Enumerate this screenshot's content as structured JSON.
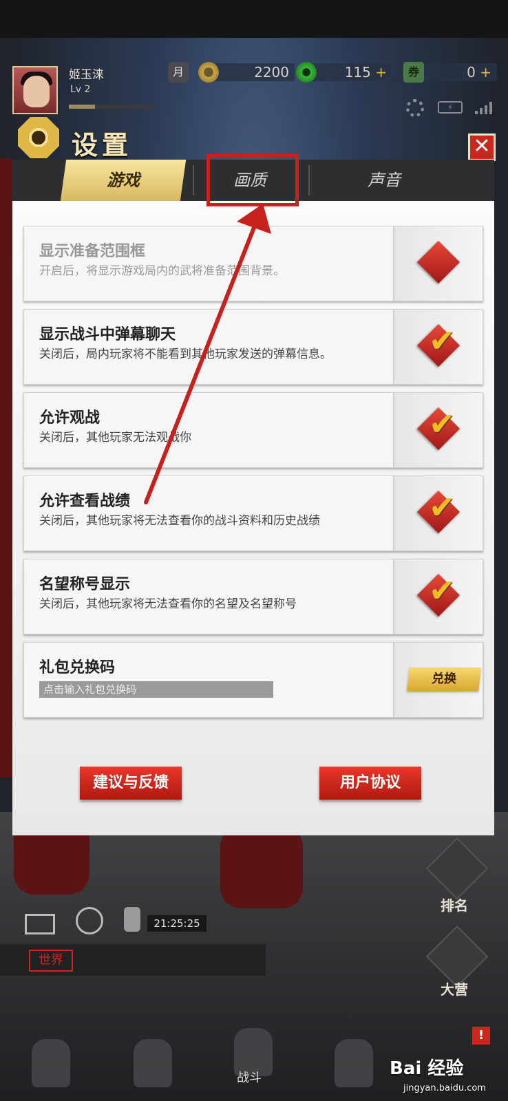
{
  "player": {
    "name": "姬玉涞",
    "level": "Lv 2",
    "xp_fraction": 0.3
  },
  "resources": {
    "coins": "2200",
    "jade": "115",
    "tickets": "0",
    "plus": "+",
    "calendar_glyph": "月",
    "ticket_glyph": "券"
  },
  "status": {
    "battery_glyph": "⚡"
  },
  "dialog": {
    "title": "设置",
    "close": "✕",
    "tabs": [
      {
        "label": "游戏",
        "active": true
      },
      {
        "label": "画质",
        "active": false,
        "highlighted": true
      },
      {
        "label": "声音",
        "active": false
      }
    ],
    "rows": [
      {
        "title": "显示准备范围框",
        "desc": "开启后，将显示游戏局内的武将准备范围背景。",
        "checked": false,
        "disabled": true
      },
      {
        "title": "显示战斗中弹幕聊天",
        "desc": "关闭后，局内玩家将不能看到其他玩家发送的弹幕信息。",
        "checked": true,
        "disabled": false
      },
      {
        "title": "允许观战",
        "desc": "关闭后，其他玩家无法观战你",
        "checked": true,
        "disabled": false
      },
      {
        "title": "允许查看战绩",
        "desc": "关闭后，其他玩家将无法查看你的战斗资料和历史战绩",
        "checked": true,
        "disabled": false
      },
      {
        "title": "名望称号显示",
        "desc": "关闭后，其他玩家将无法查看你的名望及名望称号",
        "checked": true,
        "disabled": false
      }
    ],
    "gift": {
      "title": "礼包兑换码",
      "placeholder": "点击输入礼包兑换码",
      "button": "兑换"
    },
    "feedback_button": "建议与反馈",
    "agreement_button": "用户协议"
  },
  "check_glyph": "✔",
  "hud": {
    "time": "21:25:25",
    "world_channel": "世界",
    "ranking": "排名",
    "camp": "大营",
    "battle": "战斗",
    "alert": "!"
  },
  "watermark": {
    "main": "Bai 经验",
    "sub": "jingyan.baidu.com"
  },
  "colors": {
    "accent_red": "#c8281e",
    "gold": "#e0b848",
    "tab_active": "#f0d880"
  }
}
